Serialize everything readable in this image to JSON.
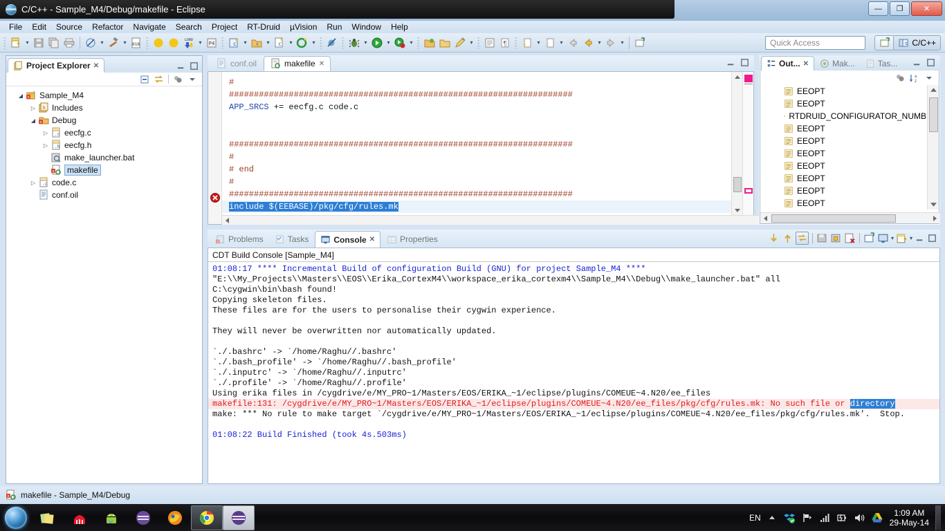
{
  "window": {
    "title": "C/C++ - Sample_M4/Debug/makefile - Eclipse",
    "minimize": "—",
    "maximize": "❐",
    "close": "✕"
  },
  "menubar": {
    "items": [
      "File",
      "Edit",
      "Source",
      "Refactor",
      "Navigate",
      "Search",
      "Project",
      "RT-Druid",
      "µVision",
      "Run",
      "Window",
      "Help"
    ]
  },
  "toolbar": {
    "quick_access_placeholder": "Quick Access",
    "perspective_label": "C/C++",
    "icons": [
      "new-file-icon",
      "save-icon",
      "save-all-icon",
      "print-icon",
      "no-build-icon",
      "build-hammer-icon",
      "binary-010-icon",
      "moon-yellow-icon",
      "moon-yellow-2-icon",
      "load-flash-icon",
      "pack-installer-icon",
      "new-c-class-icon",
      "new-c-folder-icon",
      "new-c-source-icon",
      "new-c-project-icon",
      "skip-breakpoints-icon",
      "debug-bug-icon",
      "run-green-icon",
      "run-stop-icon",
      "open-folder-icon",
      "folder-icon",
      "pencil-icon",
      "page-icon",
      "pilcrow-icon",
      "next-annotation-icon",
      "previous-annotation-icon",
      "back-arrow-icon",
      "back-yellow-arrow-icon",
      "forward-arrow-icon",
      "new-window-icon"
    ]
  },
  "project_explorer": {
    "tab_label": "Project Explorer",
    "tab_icon": "project-explorer-icon",
    "toolbar_icons": [
      "collapse-all-icon",
      "link-with-editor-icon",
      "view-menu-filter-icon",
      "view-menu-icon"
    ],
    "tree": [
      {
        "label": "Sample_M4",
        "icon": "c-project-icon",
        "indent": 0,
        "twisty": "open",
        "selected": false
      },
      {
        "label": "Includes",
        "icon": "includes-icon",
        "indent": 1,
        "twisty": "closed",
        "selected": false
      },
      {
        "label": "Debug",
        "icon": "folder-error-icon",
        "indent": 1,
        "twisty": "open",
        "selected": false
      },
      {
        "label": "eecfg.c",
        "icon": "c-file-icon",
        "indent": 2,
        "twisty": "closed",
        "selected": false
      },
      {
        "label": "eecfg.h",
        "icon": "h-file-icon",
        "indent": 2,
        "twisty": "closed",
        "selected": false
      },
      {
        "label": "make_launcher.bat",
        "icon": "bat-file-icon",
        "indent": 2,
        "twisty": "none",
        "selected": false
      },
      {
        "label": "makefile",
        "icon": "makefile-error-icon",
        "indent": 2,
        "twisty": "none",
        "selected": true
      },
      {
        "label": "code.c",
        "icon": "c-file-icon",
        "indent": 1,
        "twisty": "closed",
        "selected": false
      },
      {
        "label": "conf.oil",
        "icon": "oil-file-icon",
        "indent": 1,
        "twisty": "none",
        "selected": false
      }
    ]
  },
  "editor": {
    "tabs": [
      {
        "label": "conf.oil",
        "icon": "oil-file-icon",
        "active": false,
        "closable": false
      },
      {
        "label": "makefile",
        "icon": "makefile-icon",
        "active": true,
        "closable": true
      }
    ],
    "minimize_icon": "minimize-icon",
    "maximize_icon": "maximize-icon",
    "lines": [
      {
        "kind": "hash",
        "text": "#"
      },
      {
        "kind": "hash",
        "text": "#####################################################################"
      },
      {
        "kind": "code",
        "var": "APP_SRCS",
        "rest": " += eecfg.c code.c"
      },
      {
        "kind": "blank",
        "text": ""
      },
      {
        "kind": "blank",
        "text": ""
      },
      {
        "kind": "hash",
        "text": "#####################################################################"
      },
      {
        "kind": "hash",
        "text": "#"
      },
      {
        "kind": "hash",
        "text": "# end"
      },
      {
        "kind": "hash",
        "text": "#"
      },
      {
        "kind": "hash",
        "text": "#####################################################################"
      },
      {
        "kind": "selected",
        "text": "include $(EEBASE)/pkg/cfg/rules.mk"
      }
    ],
    "error_marker_icon": "error-marker-icon"
  },
  "outline": {
    "tabs": [
      {
        "label": "Out...",
        "icon": "outline-icon",
        "active": true,
        "closable": true
      },
      {
        "label": "Mak...",
        "icon": "make-target-icon",
        "active": false,
        "closable": false
      },
      {
        "label": "Tas...",
        "icon": "task-list-icon",
        "active": false,
        "closable": false
      }
    ],
    "toolbar_icons": [
      "filter-icon",
      "sort-az-icon",
      "view-menu-icon"
    ],
    "items": [
      "EEOPT",
      "EEOPT",
      "RTDRUID_CONFIGURATOR_NUMB",
      "EEOPT",
      "EEOPT",
      "EEOPT",
      "EEOPT",
      "EEOPT",
      "EEOPT",
      "EEOPT"
    ],
    "item_icon": "outline-entry-icon"
  },
  "console": {
    "tabs": [
      {
        "label": "Problems",
        "icon": "problems-icon",
        "active": false
      },
      {
        "label": "Tasks",
        "icon": "tasks-icon",
        "active": false
      },
      {
        "label": "Console",
        "icon": "console-icon",
        "active": true,
        "closable": true
      },
      {
        "label": "Properties",
        "icon": "properties-icon",
        "active": false
      }
    ],
    "toolbar_icons": [
      "scroll-lock-down-icon",
      "scroll-up-icon",
      "pin-console-icon",
      "save-console-icon",
      "lock-console-icon",
      "clear-console-icon",
      "open-console-icon",
      "display-console-icon",
      "new-console-icon",
      "minimize-icon",
      "maximize-icon"
    ],
    "title": "CDT Build Console [Sample_M4]",
    "lines": [
      {
        "color": "blue",
        "text": "01:08:17 **** Incremental Build of configuration Build (GNU) for project Sample_M4 ****"
      },
      {
        "color": "black",
        "text": "\"E:\\\\My_Projects\\\\Masters\\\\EOS\\\\Erika_CortexM4\\\\workspace_erika_cortexm4\\\\Sample_M4\\\\Debug\\\\make_launcher.bat\" all"
      },
      {
        "color": "black",
        "text": "C:\\cygwin\\bin\\bash found!"
      },
      {
        "color": "black",
        "text": "Copying skeleton files."
      },
      {
        "color": "black",
        "text": "These files are for the users to personalise their cygwin experience."
      },
      {
        "color": "black",
        "text": ""
      },
      {
        "color": "black",
        "text": "They will never be overwritten nor automatically updated."
      },
      {
        "color": "black",
        "text": ""
      },
      {
        "color": "black",
        "text": "`./.bashrc' -> `/home/Raghu//.bashrc'"
      },
      {
        "color": "black",
        "text": "`./.bash_profile' -> `/home/Raghu//.bash_profile'"
      },
      {
        "color": "black",
        "text": "`./.inputrc' -> `/home/Raghu//.inputrc'"
      },
      {
        "color": "black",
        "text": "`./.profile' -> `/home/Raghu//.profile'"
      },
      {
        "color": "black",
        "text": "Using erika files in /cygdrive/e/MY_PRO~1/Masters/EOS/ERIKA_~1/eclipse/plugins/COMEUE~4.N20/ee_files"
      },
      {
        "color": "red",
        "text": "makefile:131: /cygdrive/e/MY_PRO~1/Masters/EOS/ERIKA_~1/eclipse/plugins/COMEUE~4.N20/ee_files/pkg/cfg/rules.mk: No such file or ",
        "selected_tail": "directory"
      },
      {
        "color": "black",
        "text": "make: *** No rule to make target `/cygdrive/e/MY_PRO~1/Masters/EOS/ERIKA_~1/eclipse/plugins/COMEUE~4.N20/ee_files/pkg/cfg/rules.mk'.  Stop."
      },
      {
        "color": "black",
        "text": ""
      },
      {
        "color": "blue",
        "text": "01:08:22 Build Finished (took 4s.503ms)"
      }
    ]
  },
  "statusbar": {
    "icon": "makefile-icon",
    "text": "makefile - Sample_M4/Debug"
  },
  "taskbar": {
    "start_icon": "windows-start-orb",
    "pinned": [
      {
        "name": "sticky-notes-icon"
      },
      {
        "name": "red-app-icon"
      },
      {
        "name": "android-sdk-icon"
      },
      {
        "name": "eclipse-icon"
      },
      {
        "name": "firefox-icon"
      },
      {
        "name": "chrome-icon",
        "active": true
      },
      {
        "name": "eclipse-running-icon",
        "active": true
      }
    ],
    "tray": {
      "language": "EN",
      "icons": [
        "show-hidden-icons",
        "dropbox-icon",
        "network-flag-icon",
        "signal-bars-icon",
        "battery-icon",
        "volume-icon",
        "google-drive-icon"
      ],
      "time": "1:09 AM",
      "date": "29-May-14"
    }
  },
  "colors": {
    "accent_blue": "#2e7fd4",
    "error_red": "#e01b1b",
    "console_blue": "#1a23d6",
    "comment_brown": "#9c3a1f",
    "keyword_blue": "#2244aa",
    "marker_pink": "#f01a8c"
  }
}
